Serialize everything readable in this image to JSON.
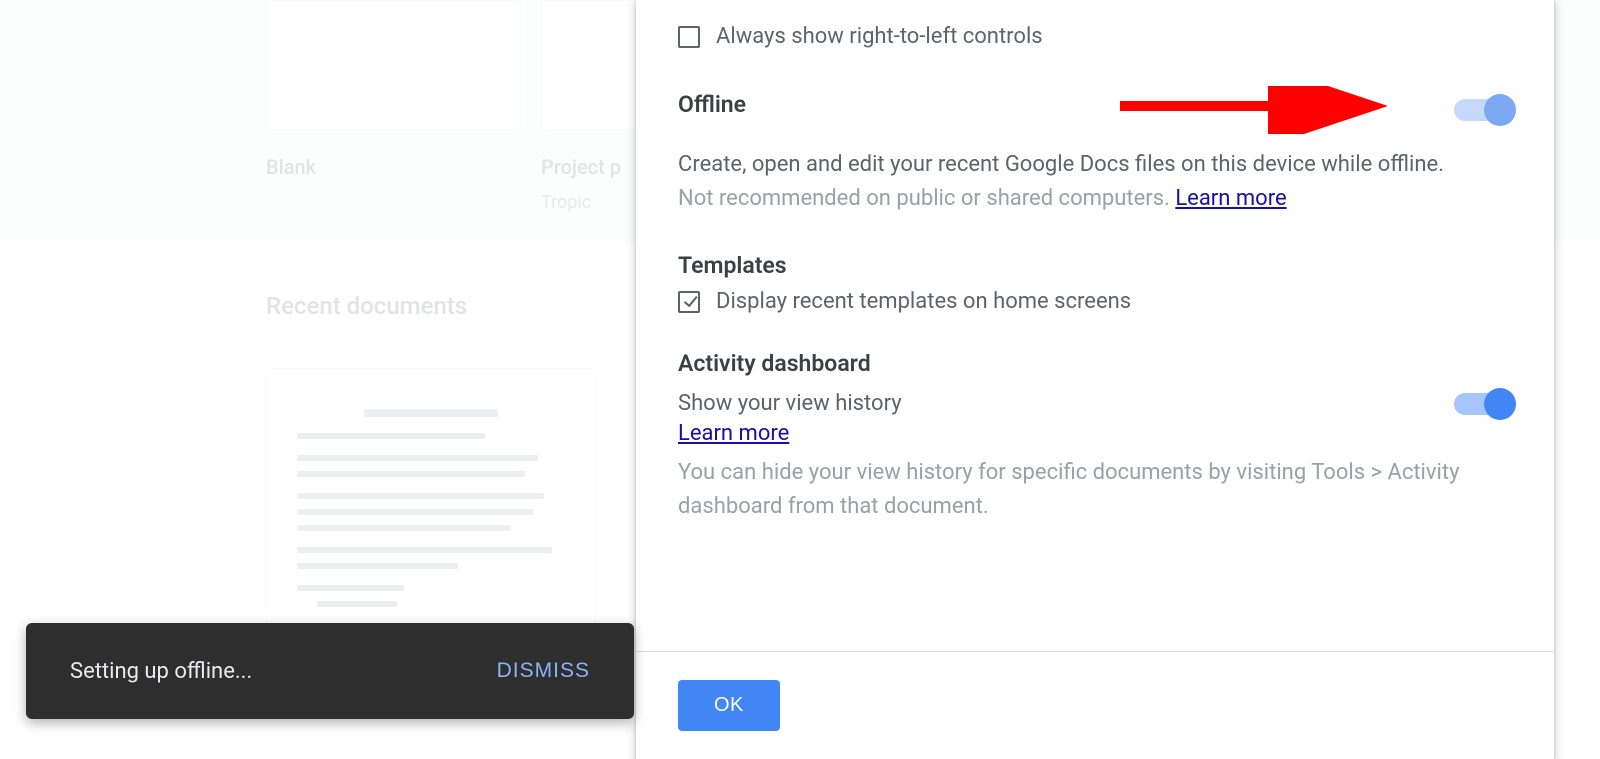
{
  "templates": {
    "blank_label": "Blank",
    "project_label": "Project p",
    "project_sublabel": "Tropic"
  },
  "recent": {
    "heading": "Recent documents"
  },
  "modal": {
    "rtl": {
      "label": "Always show right-to-left controls",
      "checked": false
    },
    "offline": {
      "heading": "Offline",
      "description": "Create, open and edit your recent Google Docs files on this device while offline.",
      "hint": "Not recommended on public or shared computers. ",
      "learn_more": "Learn more",
      "enabled": true
    },
    "templatesSection": {
      "heading": "Templates",
      "label": "Display recent templates on home screens",
      "checked": true
    },
    "activity": {
      "heading": "Activity dashboard",
      "label": "Show your view history",
      "learn_more": "Learn more",
      "hint": "You can hide your view history for specific documents by visiting Tools > Activity dashboard from that document.",
      "enabled": true
    },
    "ok": "OK"
  },
  "toast": {
    "message": "Setting up offline...",
    "action": "DISMISS"
  }
}
